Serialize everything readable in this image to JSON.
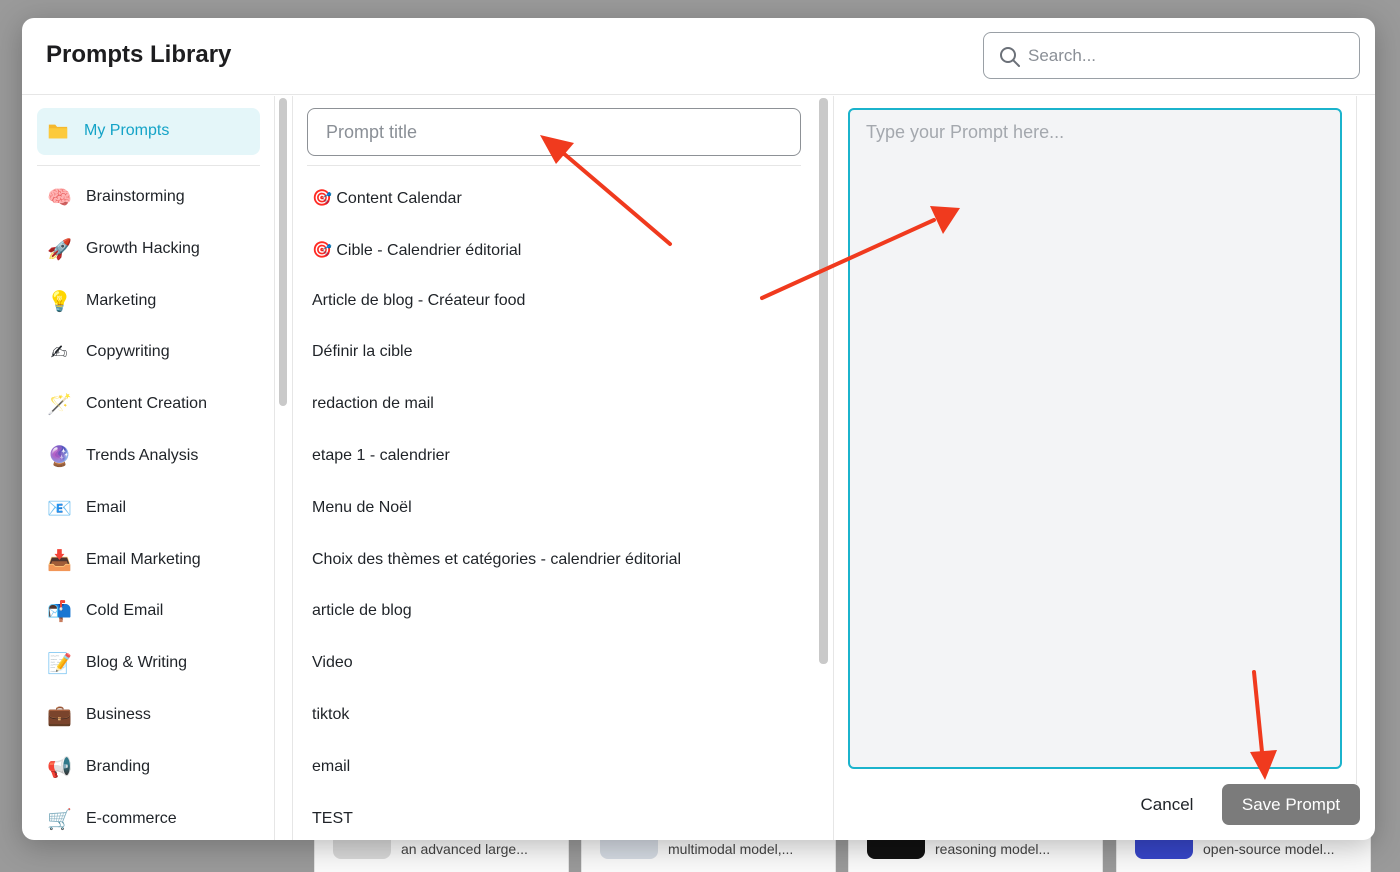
{
  "modal": {
    "title": "Prompts Library",
    "search_placeholder": "Search..."
  },
  "sidebar": {
    "active": {
      "label": "My Prompts",
      "icon": "folder-icon"
    },
    "items": [
      {
        "label": "Brainstorming",
        "icon": "brain-icon",
        "glyph": "🧠"
      },
      {
        "label": "Growth Hacking",
        "icon": "rocket-icon",
        "glyph": "🚀"
      },
      {
        "label": "Marketing",
        "icon": "lightbulb-icon",
        "glyph": "💡"
      },
      {
        "label": "Copywriting",
        "icon": "writing-hand-icon",
        "glyph": "✍"
      },
      {
        "label": "Content Creation",
        "icon": "magic-wand-icon",
        "glyph": "🪄"
      },
      {
        "label": "Trends Analysis",
        "icon": "crystal-ball-icon",
        "glyph": "🔮"
      },
      {
        "label": "Email",
        "icon": "email-icon",
        "glyph": "📧"
      },
      {
        "label": "Email Marketing",
        "icon": "inbox-tray-icon",
        "glyph": "📥"
      },
      {
        "label": "Cold Email",
        "icon": "mailbox-icon",
        "glyph": "📬"
      },
      {
        "label": "Blog & Writing",
        "icon": "memo-icon",
        "glyph": "📝"
      },
      {
        "label": "Business",
        "icon": "briefcase-icon",
        "glyph": "💼"
      },
      {
        "label": "Branding",
        "icon": "megaphone-icon",
        "glyph": "📢"
      },
      {
        "label": "E-commerce",
        "icon": "shopping-cart-icon",
        "glyph": "🛒"
      }
    ]
  },
  "editor": {
    "title_placeholder": "Prompt title",
    "body_placeholder": "Type your Prompt here...",
    "cancel_label": "Cancel",
    "save_label": "Save Prompt"
  },
  "prompts": [
    "🎯 Content Calendar",
    "🎯 Cible - Calendrier éditorial",
    "Article de blog - Créateur food",
    "Définir la cible",
    "redaction de mail",
    "etape 1 - calendrier",
    "Menu de Noël",
    "Choix des thèmes et catégories - calendrier éditorial",
    "article de blog",
    "Video",
    "tiktok",
    "email",
    "TEST"
  ],
  "background_cards": [
    {
      "text": "an advanced large...",
      "thumb_color": "#d9d9d9"
    },
    {
      "text": "multimodal model,...",
      "thumb_color": "#d5dbe3"
    },
    {
      "text": "reasoning model...",
      "thumb_color": "#111111"
    },
    {
      "text": "open-source model...",
      "thumb_color": "#3746c9"
    }
  ],
  "colors": {
    "accent": "#1bb3cc",
    "active_bg": "#e4f6f9",
    "active_text": "#14a3c7",
    "save_button": "#7b7b7b",
    "arrow": "#f03a1e"
  }
}
